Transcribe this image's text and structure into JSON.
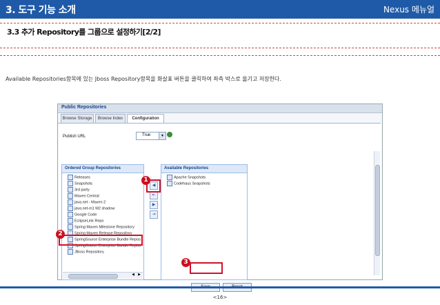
{
  "header": {
    "title": "3. 도구 기능 소개",
    "brand": "Nexus 메뉴얼"
  },
  "section": {
    "title": "3.3 추가 Repository를 그룹으로 설정하기[2/2]"
  },
  "description": "Available Repositories항목에 있는 Jboss Repository항목을 화살표 버튼을 클릭하여 좌측 박스로 옮기고 저장한다.",
  "screenshot": {
    "panel_title": "Public Repositories",
    "tabs": [
      {
        "label": "Browse Storage"
      },
      {
        "label": "Browse Index"
      },
      {
        "label": "Configuration"
      }
    ],
    "publish_url_label": "Publish URL",
    "publish_url_value": "True",
    "ordered_group": {
      "header": "Ordered Group Repositories",
      "items": [
        "Releases",
        "Snapshots",
        "3rd party",
        "Maven Central",
        "java.net - Maven 2",
        "java.net-m1 M2 shadow",
        "Google Code",
        "EclipseLink Repo",
        "Spring Maven Milestone Repository",
        "Spring Maven Release Repository",
        "SpringSource Enterprise Bundle Repos",
        "SpringSource Enterprise Bundle Repos",
        "JBoss Repository"
      ]
    },
    "available": {
      "header": "Available Repositories",
      "items": [
        "Apache Snapshots",
        "Codehaus Snapshots"
      ]
    },
    "move_buttons": [
      "◀",
      "⇤",
      "▶",
      "⇥"
    ],
    "save_label": "Save",
    "reset_label": "Reset"
  },
  "markers": [
    "1",
    "2",
    "3"
  ],
  "footer": {
    "page": "<16>"
  },
  "colors": {
    "brand_blue": "#1f5aa8",
    "highlight_red": "#d0102a"
  }
}
